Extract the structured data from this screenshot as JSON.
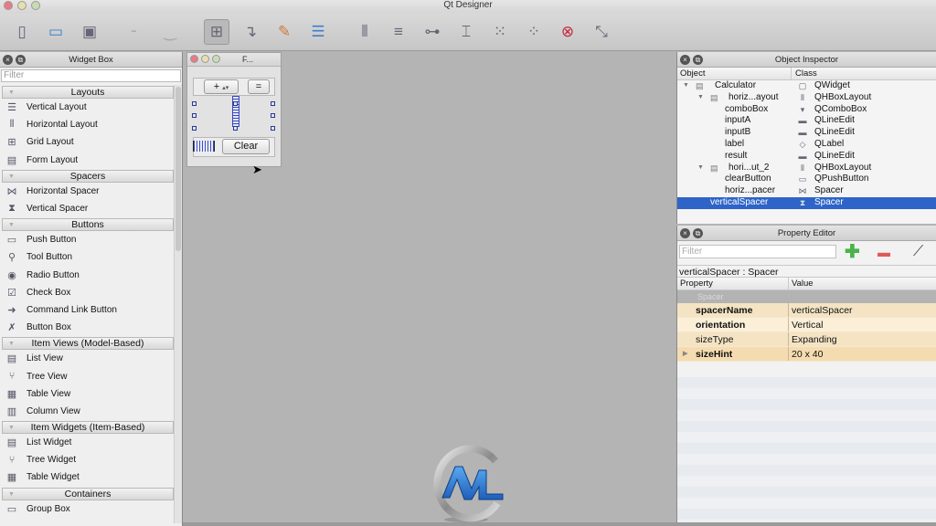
{
  "app": {
    "title": "Qt Designer"
  },
  "toolbar": {
    "buttons": [
      {
        "name": "new-form-icon",
        "glyph": "▯"
      },
      {
        "name": "open-form-icon",
        "glyph": "▭"
      },
      {
        "name": "save-form-icon",
        "glyph": "▣"
      },
      {
        "name": "undo-icon",
        "glyph": "╴"
      },
      {
        "name": "redo-icon",
        "glyph": "‿"
      },
      {
        "name": "edit-widgets-icon",
        "glyph": "⊞"
      },
      {
        "name": "edit-signals-slots-icon",
        "glyph": "↴"
      },
      {
        "name": "edit-buddies-icon",
        "glyph": "✎"
      },
      {
        "name": "edit-tab-order-icon",
        "glyph": "☰"
      },
      {
        "name": "lay-out-horizontally-icon",
        "glyph": "⦀"
      },
      {
        "name": "lay-out-vertically-icon",
        "glyph": "≡"
      },
      {
        "name": "horizontal-splitter-icon",
        "glyph": "⊶"
      },
      {
        "name": "vertical-splitter-icon",
        "glyph": "⌶"
      },
      {
        "name": "grid-layout-icon",
        "glyph": "⁙"
      },
      {
        "name": "form-layout-icon",
        "glyph": "⁘"
      },
      {
        "name": "break-layout-icon",
        "glyph": "⊗"
      },
      {
        "name": "adjust-size-icon",
        "glyph": "⤡"
      }
    ]
  },
  "widget_box": {
    "title": "Widget Box",
    "filter_placeholder": "Filter",
    "categories": [
      {
        "label": "Layouts",
        "items": [
          {
            "label": "Vertical Layout",
            "icon": "vertical-layout-icon",
            "glyph": "☰"
          },
          {
            "label": "Horizontal Layout",
            "icon": "horizontal-layout-icon",
            "glyph": "⦀"
          },
          {
            "label": "Grid Layout",
            "icon": "grid-layout-icon",
            "glyph": "⊞"
          },
          {
            "label": "Form Layout",
            "icon": "form-layout-icon",
            "glyph": "▤"
          }
        ]
      },
      {
        "label": "Spacers",
        "items": [
          {
            "label": "Horizontal Spacer",
            "icon": "horizontal-spacer-icon",
            "glyph": "⋈"
          },
          {
            "label": "Vertical Spacer",
            "icon": "vertical-spacer-icon",
            "glyph": "⧗"
          }
        ]
      },
      {
        "label": "Buttons",
        "items": [
          {
            "label": "Push Button",
            "icon": "push-button-icon",
            "glyph": "▭"
          },
          {
            "label": "Tool Button",
            "icon": "tool-button-icon",
            "glyph": "⚲"
          },
          {
            "label": "Radio Button",
            "icon": "radio-button-icon",
            "glyph": "◉"
          },
          {
            "label": "Check Box",
            "icon": "check-box-icon",
            "glyph": "☑"
          },
          {
            "label": "Command Link Button",
            "icon": "command-link-button-icon",
            "glyph": "➜"
          },
          {
            "label": "Button Box",
            "icon": "button-box-icon",
            "glyph": "✗"
          }
        ]
      },
      {
        "label": "Item Views (Model-Based)",
        "items": [
          {
            "label": "List View",
            "icon": "list-view-icon",
            "glyph": "▤"
          },
          {
            "label": "Tree View",
            "icon": "tree-view-icon",
            "glyph": "⑂"
          },
          {
            "label": "Table View",
            "icon": "table-view-icon",
            "glyph": "▦"
          },
          {
            "label": "Column View",
            "icon": "column-view-icon",
            "glyph": "▥"
          }
        ]
      },
      {
        "label": "Item Widgets (Item-Based)",
        "items": [
          {
            "label": "List Widget",
            "icon": "list-widget-icon",
            "glyph": "▤"
          },
          {
            "label": "Tree Widget",
            "icon": "tree-widget-icon",
            "glyph": "⑂"
          },
          {
            "label": "Table Widget",
            "icon": "table-widget-icon",
            "glyph": "▦"
          }
        ]
      },
      {
        "label": "Containers",
        "items": [
          {
            "label": "Group Box",
            "icon": "group-box-icon",
            "glyph": "▭"
          }
        ]
      }
    ]
  },
  "form": {
    "title": "F...",
    "combo_value": "+",
    "equals_label": "=",
    "clear_label": "Clear"
  },
  "object_inspector": {
    "title": "Object Inspector",
    "columns": [
      "Object",
      "Class"
    ],
    "rows": [
      {
        "object": "Calculator",
        "class": "QWidget",
        "depth": 0,
        "expanded": true,
        "selected": false,
        "glyph": "▢"
      },
      {
        "object": "horiz...ayout",
        "class": "QHBoxLayout",
        "depth": 1,
        "expanded": true,
        "selected": false,
        "glyph": "⦀"
      },
      {
        "object": "comboBox",
        "class": "QComboBox",
        "depth": 2,
        "selected": false,
        "glyph": "▾"
      },
      {
        "object": "inputA",
        "class": "QLineEdit",
        "depth": 2,
        "selected": false,
        "glyph": "▬"
      },
      {
        "object": "inputB",
        "class": "QLineEdit",
        "depth": 2,
        "selected": false,
        "glyph": "▬"
      },
      {
        "object": "label",
        "class": "QLabel",
        "depth": 2,
        "selected": false,
        "glyph": "◇"
      },
      {
        "object": "result",
        "class": "QLineEdit",
        "depth": 2,
        "selected": false,
        "glyph": "▬"
      },
      {
        "object": "hori...ut_2",
        "class": "QHBoxLayout",
        "depth": 1,
        "expanded": true,
        "selected": false,
        "glyph": "⦀"
      },
      {
        "object": "clearButton",
        "class": "QPushButton",
        "depth": 2,
        "selected": false,
        "glyph": "▭"
      },
      {
        "object": "horiz...pacer",
        "class": "Spacer",
        "depth": 2,
        "selected": false,
        "glyph": "⋈"
      },
      {
        "object": "verticalSpacer",
        "class": "Spacer",
        "depth": 0,
        "selected": true,
        "glyph": "⧗"
      }
    ]
  },
  "property_editor": {
    "title": "Property Editor",
    "filter_placeholder": "Filter",
    "object_label": "verticalSpacer : Spacer",
    "columns": [
      "Property",
      "Value"
    ],
    "group": "Spacer",
    "rows": [
      {
        "property": "spacerName",
        "value": "verticalSpacer",
        "bold": true,
        "expandable": false
      },
      {
        "property": "orientation",
        "value": "Vertical",
        "bold": true,
        "expandable": false
      },
      {
        "property": "sizeType",
        "value": "Expanding",
        "bold": false,
        "expandable": false
      },
      {
        "property": "sizeHint",
        "value": "20 x 40",
        "bold": true,
        "expandable": true
      }
    ]
  },
  "colors": {
    "selection": "#2e64c8",
    "property_row": "#f4e4c4",
    "canvas": "#b4b4b4"
  }
}
